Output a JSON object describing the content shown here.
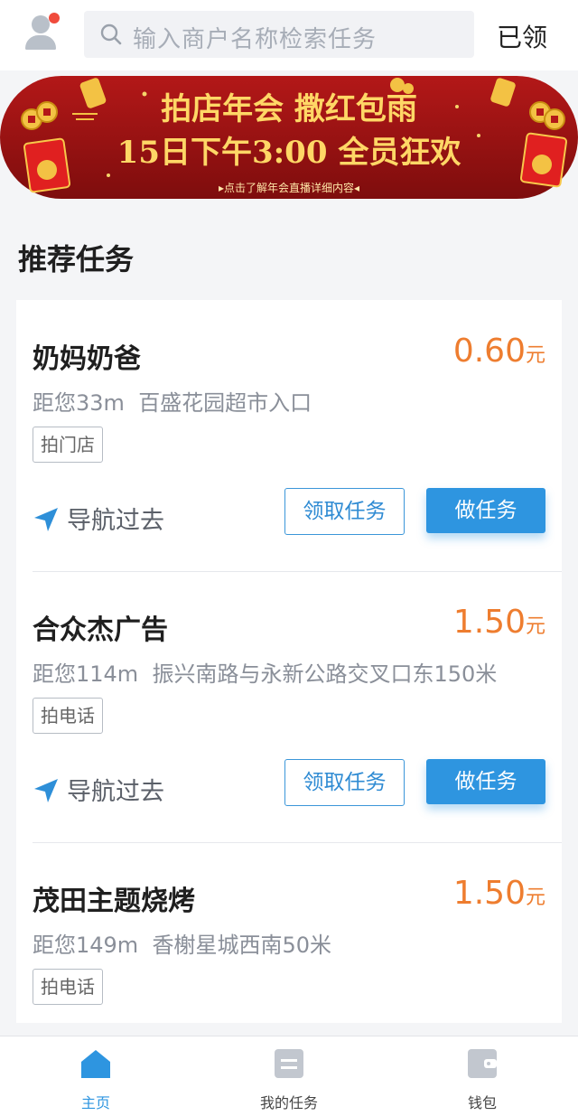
{
  "header": {
    "search_placeholder": "输入商户名称检索任务",
    "claimed_label": "已领"
  },
  "banner": {
    "title_line1": "拍店年会   撒红包雨",
    "title_line2": "15日下午3:00   全员狂欢",
    "sub_text": "▸点击了解年会直播详细内容◂"
  },
  "section_title": "推荐任务",
  "tasks": [
    {
      "name": "奶妈奶爸",
      "price": "0.60",
      "unit": "元",
      "distance": "距您33m",
      "address": "百盛花园超市入口",
      "tag": "拍门店",
      "nav_label": "导航过去",
      "claim_label": "领取任务",
      "do_label": "做任务"
    },
    {
      "name": "合众杰广告",
      "price": "1.50",
      "unit": "元",
      "distance": "距您114m",
      "address": "振兴南路与永新公路交叉口东150米",
      "tag": "拍电话",
      "nav_label": "导航过去",
      "claim_label": "领取任务",
      "do_label": "做任务"
    },
    {
      "name": "茂田主题烧烤",
      "price": "1.50",
      "unit": "元",
      "distance": "距您149m",
      "address": "香榭星城西南50米",
      "tag": "拍电话"
    }
  ],
  "tabbar": {
    "items": [
      {
        "label": "主页",
        "icon": "home-icon",
        "active": true
      },
      {
        "label": "我的任务",
        "icon": "task-list-icon",
        "active": false
      },
      {
        "label": "钱包",
        "icon": "wallet-icon",
        "active": false
      }
    ]
  },
  "colors": {
    "accent": "#2e95e0",
    "price": "#ee7d2f",
    "banner_red": "#a01414",
    "banner_gold": "#ffd766"
  }
}
